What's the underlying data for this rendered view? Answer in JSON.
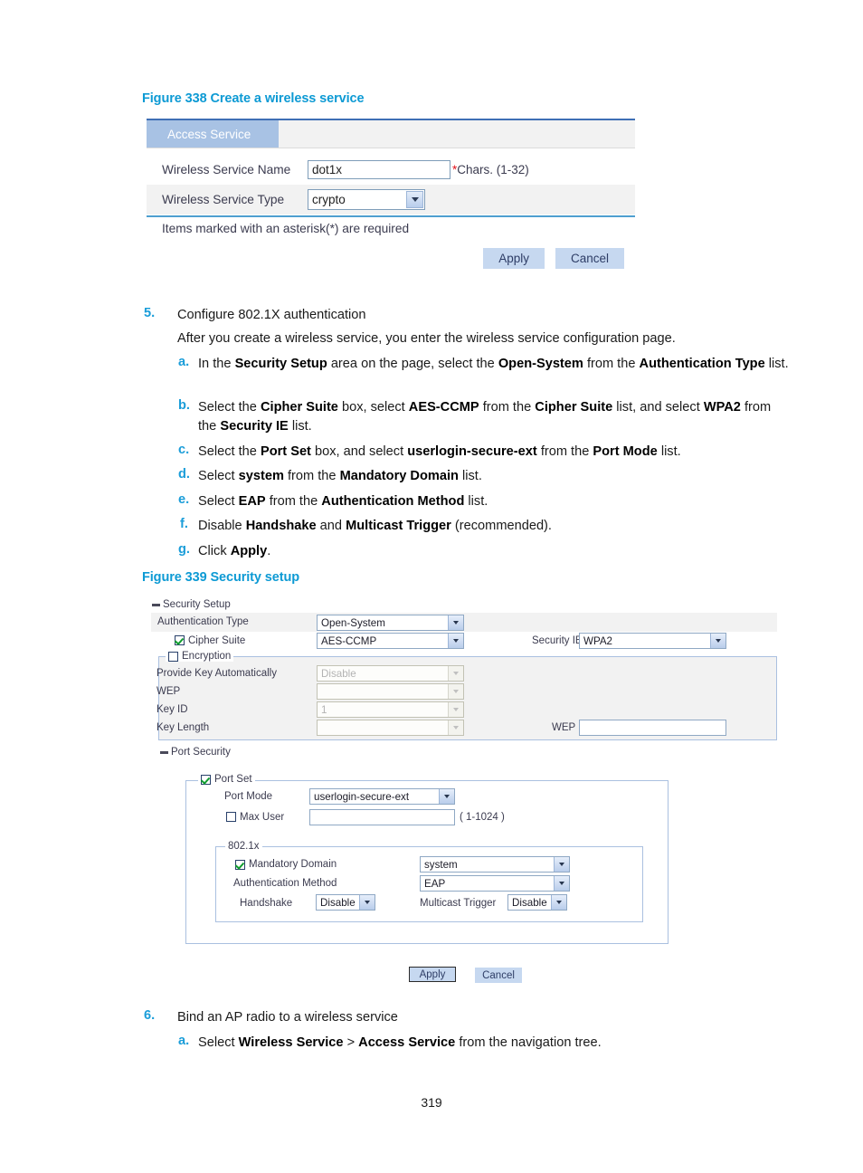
{
  "page_number": "319",
  "figure338": {
    "caption": "Figure 338 Create a wireless service",
    "tab_label": "Access Service",
    "fields": {
      "name_label": "Wireless Service Name",
      "name_value": "dot1x",
      "name_hint_asterisk": "*",
      "name_hint": "Chars. (1-32)",
      "type_label": "Wireless Service Type",
      "type_value": "crypto"
    },
    "required_note": "Items marked with an asterisk(*) are required",
    "apply_label": "Apply",
    "cancel_label": "Cancel"
  },
  "steps": {
    "step5_num": "5.",
    "step5_title": "Configure 802.1X authentication",
    "step5_intro": "After you create a wireless service, you enter the wireless service configuration page.",
    "items": [
      {
        "marker": "a.",
        "html": "In the <b>Security Setup</b> area on the page, select the <b>Open-System</b> from the <b>Authentication Type</b> list."
      },
      {
        "marker": "b.",
        "html": "Select the <b>Cipher Suite</b> box, select <b>AES-CCMP</b> from the <b>Cipher Suite</b> list, and select <b>WPA2</b> from the <b>Security IE</b> list."
      },
      {
        "marker": "c.",
        "html": "Select the <b>Port Set</b> box, and select <b>userlogin-secure-ext</b> from the <b>Port Mode</b> list."
      },
      {
        "marker": "d.",
        "html": "Select <b>system</b> from the <b>Mandatory Domain</b> list."
      },
      {
        "marker": "e.",
        "html": "Select <b>EAP</b> from the <b>Authentication Method</b> list."
      },
      {
        "marker": "f.",
        "html": "Disable <b>Handshake</b> and <b>Multicast Trigger</b> (recommended)."
      },
      {
        "marker": "g.",
        "html": "Click <b>Apply</b>."
      }
    ],
    "step6_num": "6.",
    "step6_title": "Bind an AP radio to a wireless service",
    "step6_a_marker": "a.",
    "step6_a_html": "Select <b>Wireless Service</b> &gt; <b>Access Service</b> from the navigation tree."
  },
  "figure339": {
    "caption": "Figure 339 Security setup",
    "security_setup": {
      "header": "Security Setup",
      "auth_type_label": "Authentication Type",
      "auth_type_value": "Open-System",
      "cipher_suite_label": "Cipher Suite",
      "cipher_suite_checked": true,
      "cipher_suite_value": "AES-CCMP",
      "security_ie_label": "Security IE",
      "security_ie_value": "WPA2",
      "encryption_label": "Encryption",
      "encryption_checked": false,
      "provide_key_label": "Provide Key Automatically",
      "provide_key_value": "Disable",
      "wep_label": "WEP",
      "wep_value": "",
      "key_id_label": "Key ID",
      "key_id_value": "1",
      "key_length_label": "Key Length",
      "key_length_value": "",
      "wep_key_label": "WEP Key",
      "wep_key_value": ""
    },
    "port_security": {
      "header": "Port Security",
      "port_set_label": "Port Set",
      "port_set_checked": true,
      "port_mode_label": "Port Mode",
      "port_mode_value": "userlogin-secure-ext",
      "max_user_label": "Max User",
      "max_user_checked": false,
      "max_user_value": "",
      "max_user_range": "( 1-1024 )",
      "dot1x_legend": "802.1x",
      "mandatory_domain_label": "Mandatory Domain",
      "mandatory_domain_checked": true,
      "mandatory_domain_value": "system",
      "auth_method_label": "Authentication Method",
      "auth_method_value": "EAP",
      "handshake_label": "Handshake",
      "handshake_value": "Disable",
      "multicast_trigger_label": "Multicast Trigger",
      "multicast_trigger_value": "Disable"
    },
    "apply_label": "Apply",
    "cancel_label": "Cancel"
  }
}
